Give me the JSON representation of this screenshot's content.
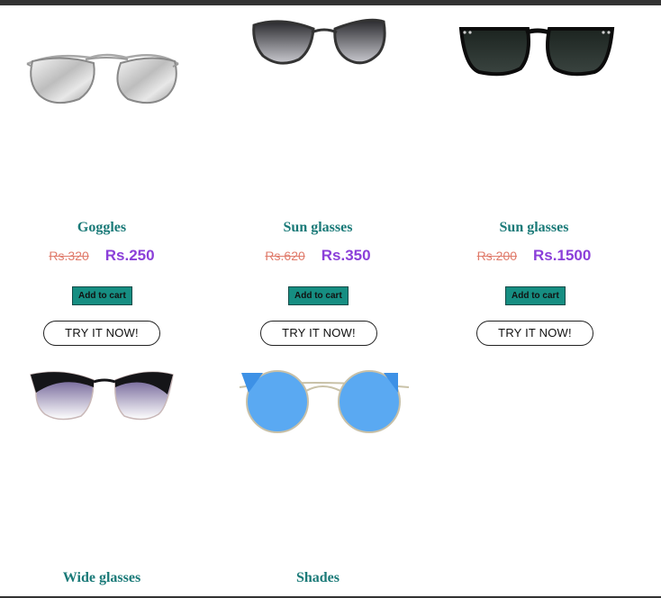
{
  "products": [
    {
      "name": "Goggles",
      "old_price": "Rs.320",
      "new_price": "Rs.250",
      "cart_label": "Add to cart",
      "try_label": "TRY IT NOW!",
      "image_icon": "aviator-sunglasses-icon"
    },
    {
      "name": "Sun glasses",
      "old_price": "Rs.620",
      "new_price": "Rs.350",
      "cart_label": "Add to cart",
      "try_label": "TRY IT NOW!",
      "image_icon": "cat-eye-sunglasses-icon"
    },
    {
      "name": "Sun glasses",
      "old_price": "Rs.200",
      "new_price": "Rs.1500",
      "cart_label": "Add to cart",
      "try_label": "TRY IT NOW!",
      "image_icon": "wayfarer-sunglasses-icon"
    },
    {
      "name": "Wide glasses",
      "image_icon": "half-rim-sunglasses-icon"
    },
    {
      "name": "Shades",
      "image_icon": "round-blue-shades-icon"
    }
  ],
  "colors": {
    "product_name": "#1a7a78",
    "old_price": "#e07b6b",
    "new_price": "#8b3fd9",
    "cart_button": "#168e82",
    "top_bar": "#333333"
  }
}
